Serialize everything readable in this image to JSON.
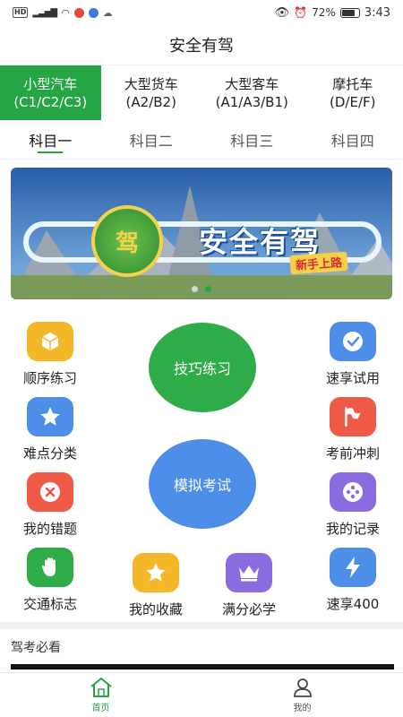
{
  "status_bar": {
    "hd": "HD",
    "signal": "⁴ᴳ",
    "battery": "72%",
    "time": "3:43"
  },
  "header": {
    "title": "安全有驾"
  },
  "vehicle_tabs": [
    {
      "name": "小型汽车",
      "code": "(C1/C2/C3)",
      "active": true
    },
    {
      "name": "大型货车",
      "code": "(A2/B2)",
      "active": false
    },
    {
      "name": "大型客车",
      "code": "(A1/A3/B1)",
      "active": false
    },
    {
      "name": "摩托车",
      "code": "(D/E/F)",
      "active": false
    }
  ],
  "subject_tabs": [
    "科目一",
    "科目二",
    "科目三",
    "科目四"
  ],
  "active_subject": 0,
  "banner": {
    "title": "安全有驾",
    "badge": "驾",
    "subtitle": "新手上路"
  },
  "features": {
    "sequential": "顺序练习",
    "quick_trial": "速享试用",
    "difficult": "难点分类",
    "sprint": "考前冲刺",
    "mistakes": "我的错题",
    "records": "我的记录",
    "traffic_signs": "交通标志",
    "favorites": "我的收藏",
    "full_score": "满分必学",
    "quick_400": "速享400"
  },
  "big_buttons": {
    "skills": "技巧练习",
    "mock_exam": "模拟考试"
  },
  "section": {
    "must_see": "驾考必看"
  },
  "bottom_nav": {
    "home": "首页",
    "mine": "我的"
  },
  "colors": {
    "accent": "#25a544",
    "yellow": "#f5b72a",
    "blue": "#4d8fe8",
    "red": "#ef5a46",
    "purple": "#8b6ce0",
    "green": "#2eac47"
  }
}
